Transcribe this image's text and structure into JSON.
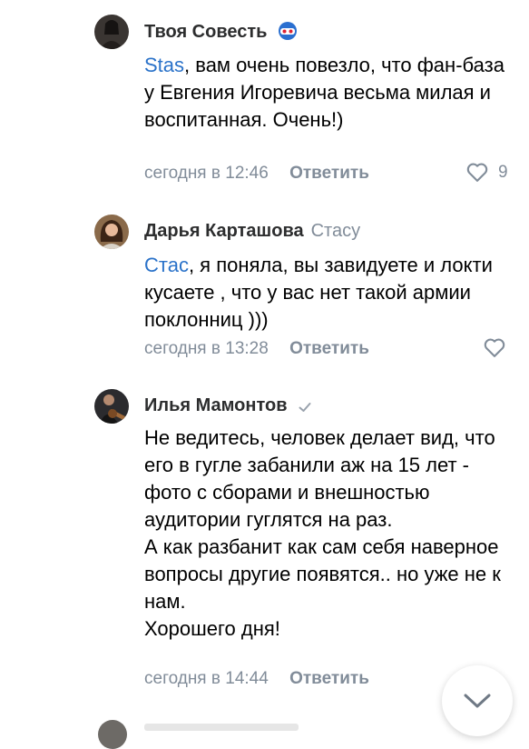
{
  "comments": [
    {
      "author": "Твоя Совесть",
      "mention": "Stas",
      "text": ", вам очень повезло, что фан-база у Евгения Игоревича весьма милая и воспитанная. Очень!)",
      "time": "сегодня в 12:46",
      "reply_label": "Ответить",
      "likes": "9",
      "avatar_icon": "dark-portrait-avatar",
      "badge_icon": "mask-emoji-icon"
    },
    {
      "author": "Дарья Карташова",
      "reply_to": "Стасу",
      "mention": "Стас",
      "text": ", я поняла, вы завидуете и локти кусаете , что у вас нет такой армии поклонниц )))",
      "time": "сегодня в 13:28",
      "reply_label": "Ответить",
      "avatar_icon": "woman-portrait-avatar"
    },
    {
      "author": "Илья Мамонтов",
      "text": "Не ведитесь, человек делает вид, что его в гугле забанили аж на 15 лет - фото с сборами и внешностью аудитории гуглятся на раз.\nА как разбанит как сам себя наверное вопросы другие появятся.. но уже не к нам.\nХорошего дня!",
      "time": "сегодня в 14:44",
      "reply_label": "Ответить",
      "avatar_icon": "guitarist-avatar",
      "badge_icon": "verified-check-icon"
    }
  ],
  "colors": {
    "link": "#2a72c9",
    "secondary": "#818c99",
    "author": "#2c2d2e"
  },
  "scroll_button_icon": "chevron-down-icon"
}
